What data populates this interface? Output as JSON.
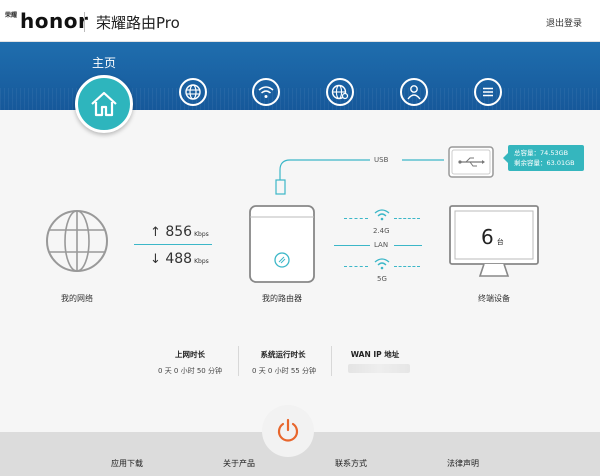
{
  "header": {
    "brand_mark": "荣耀",
    "brand_word": "honor",
    "app_title": "荣耀路由Pro",
    "logout_label": "退出登录"
  },
  "nav": {
    "home_label": "主页",
    "icons": [
      "home-icon",
      "globe-icon",
      "wifi-icon",
      "web-settings-icon",
      "user-icon",
      "menu-icon"
    ]
  },
  "network": {
    "label": "我的网络",
    "upload_value": "856",
    "upload_unit": "Kbps",
    "download_value": "488",
    "download_unit": "Kbps"
  },
  "router": {
    "label": "我的路由器",
    "usb_label": "USB",
    "band_24": "2.4G",
    "lan_label": "LAN",
    "band_5": "5G"
  },
  "storage": {
    "total_label": "总容量：74.53GB",
    "free_label": "剩余容量：63.01GB"
  },
  "devices": {
    "count": "6",
    "unit": "台",
    "label": "终端设备"
  },
  "stats": {
    "online_title": "上网时长",
    "online_value": "0 天 0 小时 50 分钟",
    "uptime_title": "系统运行时长",
    "uptime_value": "0 天 0 小时 55 分钟",
    "wan_title": "WAN IP 地址"
  },
  "footer": {
    "links": [
      "应用下载",
      "关于产品",
      "联系方式",
      "法律声明"
    ]
  },
  "colors": {
    "accent": "#2eb5bd",
    "nav_blue": "#1a64a4",
    "power_orange": "#e8662c"
  }
}
